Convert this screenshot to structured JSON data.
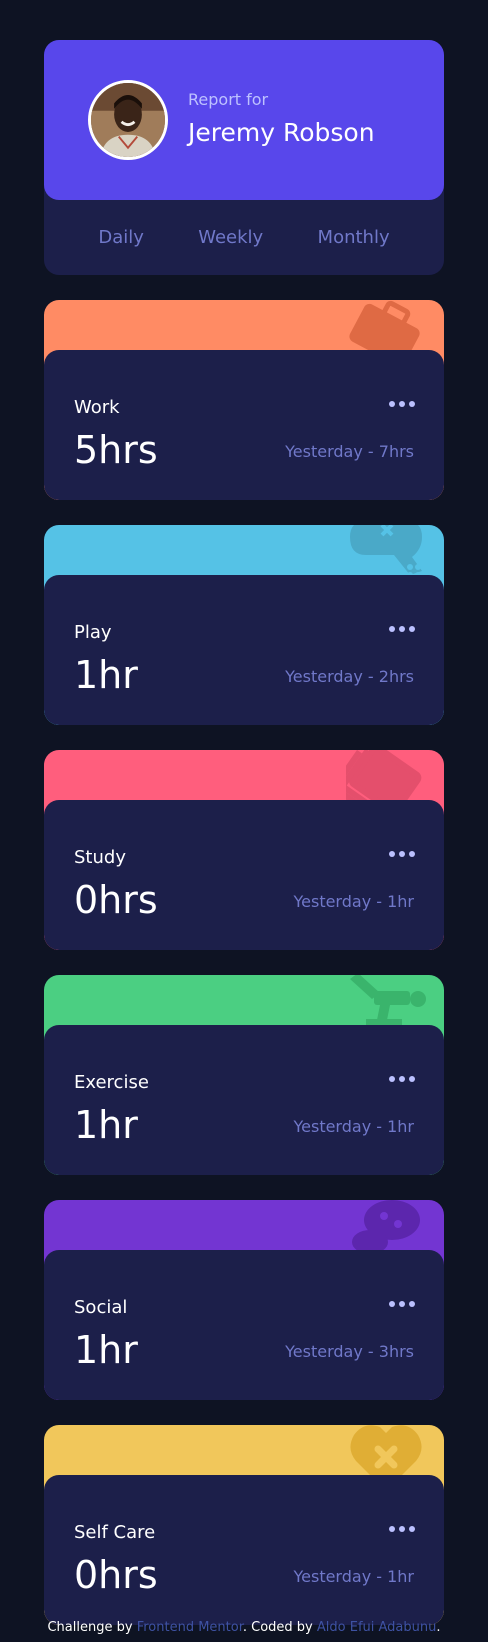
{
  "profile": {
    "report_for": "Report for",
    "name": "Jeremy Robson",
    "tabs": [
      "Daily",
      "Weekly",
      "Monthly"
    ]
  },
  "cards": [
    {
      "title": "Work",
      "current": "5hrs",
      "previous": "Yesterday - 7hrs",
      "color": "#ff8b64",
      "icon": "briefcase-icon"
    },
    {
      "title": "Play",
      "current": "1hr",
      "previous": "Yesterday - 2hrs",
      "color": "#55c2e6",
      "icon": "gamepad-icon"
    },
    {
      "title": "Study",
      "current": "0hrs",
      "previous": "Yesterday - 1hr",
      "color": "#ff5e7d",
      "icon": "book-icon"
    },
    {
      "title": "Exercise",
      "current": "1hr",
      "previous": "Yesterday - 1hr",
      "color": "#4bcf82",
      "icon": "running-icon"
    },
    {
      "title": "Social",
      "current": "1hr",
      "previous": "Yesterday - 3hrs",
      "color": "#7335d2",
      "icon": "chat-icon"
    },
    {
      "title": "Self Care",
      "current": "0hrs",
      "previous": "Yesterday - 1hr",
      "color": "#f1c75b",
      "icon": "heart-icon"
    }
  ],
  "attribution": {
    "prefix": "Challenge by",
    "challenge_link": "Frontend Mentor",
    "middle": ". Coded by",
    "author_link": "Aldo Efui Adabunu",
    "suffix": "."
  },
  "colors": {
    "background": "#0e1323",
    "card": "#1c1f4a",
    "accent": "#5847eb",
    "muted_text": "#7078c9"
  }
}
